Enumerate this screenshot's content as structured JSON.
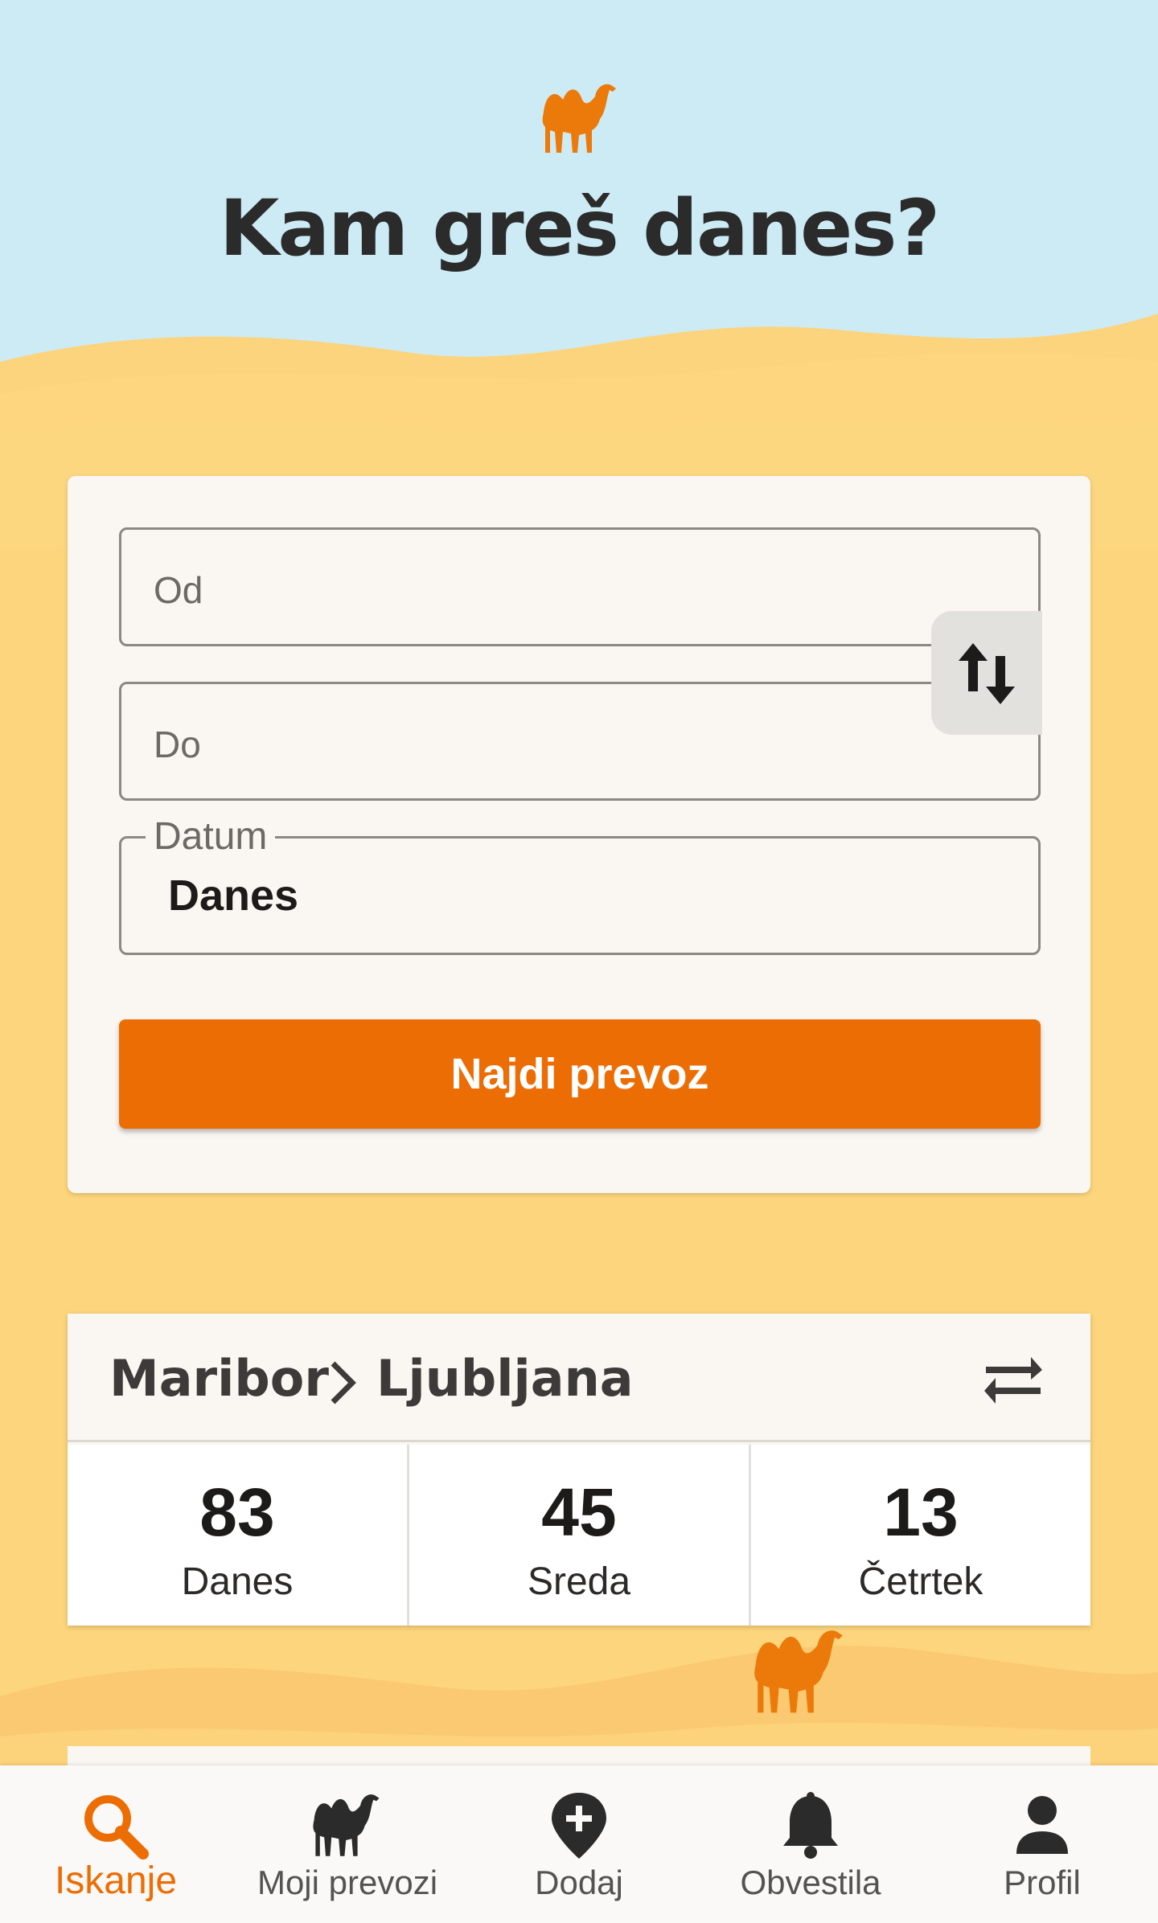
{
  "header": {
    "title": "Kam greš danes?",
    "logo_icon": "camel-icon"
  },
  "search": {
    "from_placeholder": "Od",
    "to_placeholder": "Do",
    "date_label": "Datum",
    "date_value": "Danes",
    "swap_icon": "swap-vertical-icon",
    "submit_label": "Najdi prevoz"
  },
  "route": {
    "from": "Maribor",
    "to": "Ljubljana",
    "swap_icon": "swap-horizontal-icon",
    "stats": [
      {
        "count": "83",
        "day": "Danes"
      },
      {
        "count": "45",
        "day": "Sreda"
      },
      {
        "count": "13",
        "day": "Četrtek"
      }
    ]
  },
  "nav": {
    "items": [
      {
        "label": "Iskanje",
        "icon": "search-icon",
        "active": true
      },
      {
        "label": "Moji prevozi",
        "icon": "camel-icon",
        "active": false
      },
      {
        "label": "Dodaj",
        "icon": "add-location-icon",
        "active": false
      },
      {
        "label": "Obvestila",
        "icon": "bell-icon",
        "active": false
      },
      {
        "label": "Profil",
        "icon": "person-icon",
        "active": false
      }
    ]
  },
  "colors": {
    "accent": "#ec6d04",
    "sky": "#cdebf4",
    "sand": "#fdd57c"
  }
}
